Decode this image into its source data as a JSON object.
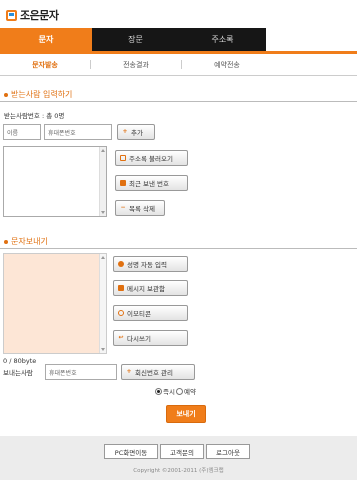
{
  "app": {
    "logo_text": "조은문자"
  },
  "top_tabs": [
    {
      "label": "문자",
      "active": true
    },
    {
      "label": "장문",
      "active": false
    },
    {
      "label": "주소록",
      "active": false
    }
  ],
  "sub_tabs": [
    {
      "label": "문자발송",
      "active": true
    },
    {
      "label": "전송결과",
      "active": false
    },
    {
      "label": "예약전송",
      "active": false
    }
  ],
  "recipients": {
    "section_title": "받는사람 입력하기",
    "count_text": "받는사람번호 : 총 0명",
    "name_placeholder": "이름",
    "phone_placeholder": "휴대폰번호",
    "add_button": "추가",
    "load_address_button": "주소록 불러오기",
    "recent_button": "최근 보낸 번호",
    "delete_button": "목록 삭제"
  },
  "message": {
    "section_title": "문자보내기",
    "auto_name_button": "성명 자동 입력",
    "save_button": "메시지 보관함",
    "emoticon_button": "이모티콘",
    "rewrite_button": "다시쓰기",
    "byte_counter": "0 / 80byte",
    "sender_label": "보내는사람",
    "sender_placeholder": "휴대폰번호",
    "reply_manage_button": "회신번호 관리",
    "option_now": "즉시",
    "option_reserve": "예약",
    "send_button": "보내기"
  },
  "footer": {
    "pc_button": "PC화면이동",
    "support_button": "고객문의",
    "logout_button": "로그아웃",
    "copyright": "Copyright ©2001-2011 (주)엠크랩"
  },
  "colors": {
    "accent": "#f07d1a",
    "nav_bg": "#161616",
    "message_bg": "#fde6d6"
  }
}
